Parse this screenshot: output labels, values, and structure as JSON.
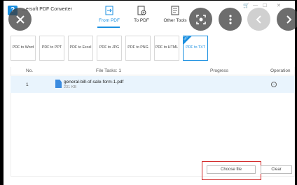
{
  "app": {
    "title": "Wondershare PDF Converter",
    "title_visible": "...ersoft PDF Converter",
    "brand_letter": "?"
  },
  "nav": [
    {
      "label": "From PDF",
      "icon": "from-pdf-icon",
      "active": true
    },
    {
      "label": "To PDF",
      "icon": "to-pdf-icon",
      "active": false
    },
    {
      "label": "Other Tools",
      "icon": "other-tools-icon",
      "active": false
    }
  ],
  "conversions": [
    {
      "label": "PDF to Word"
    },
    {
      "label": "PDF to PPT"
    },
    {
      "label": "PDF to Excel"
    },
    {
      "label": "PDF to JPG"
    },
    {
      "label": "PDF to PNG"
    },
    {
      "label": "PDF to HTML"
    },
    {
      "label": "PDF to TXT",
      "badge": "NEW",
      "active": true
    }
  ],
  "table": {
    "col_no": "No.",
    "col_file": "File Tasks: 1",
    "col_progress": "Progress",
    "col_operation": "Operation",
    "rows": [
      {
        "no": "1",
        "name": "general-bill-of-sale-form-1.pdf",
        "size": "231 KB",
        "op_icon": "remove-icon"
      }
    ]
  },
  "buttons": {
    "choose": "Choose file",
    "clear": "Clear"
  },
  "overlay": {
    "close": "close-icon",
    "screenshot": "screenshot-icon",
    "more": "more-options-icon",
    "back": "back-icon",
    "forward": "forward-icon"
  },
  "colors": {
    "accent": "#1a8fe0",
    "highlight": "#d02020",
    "row_selected": "#e9f4fd"
  }
}
